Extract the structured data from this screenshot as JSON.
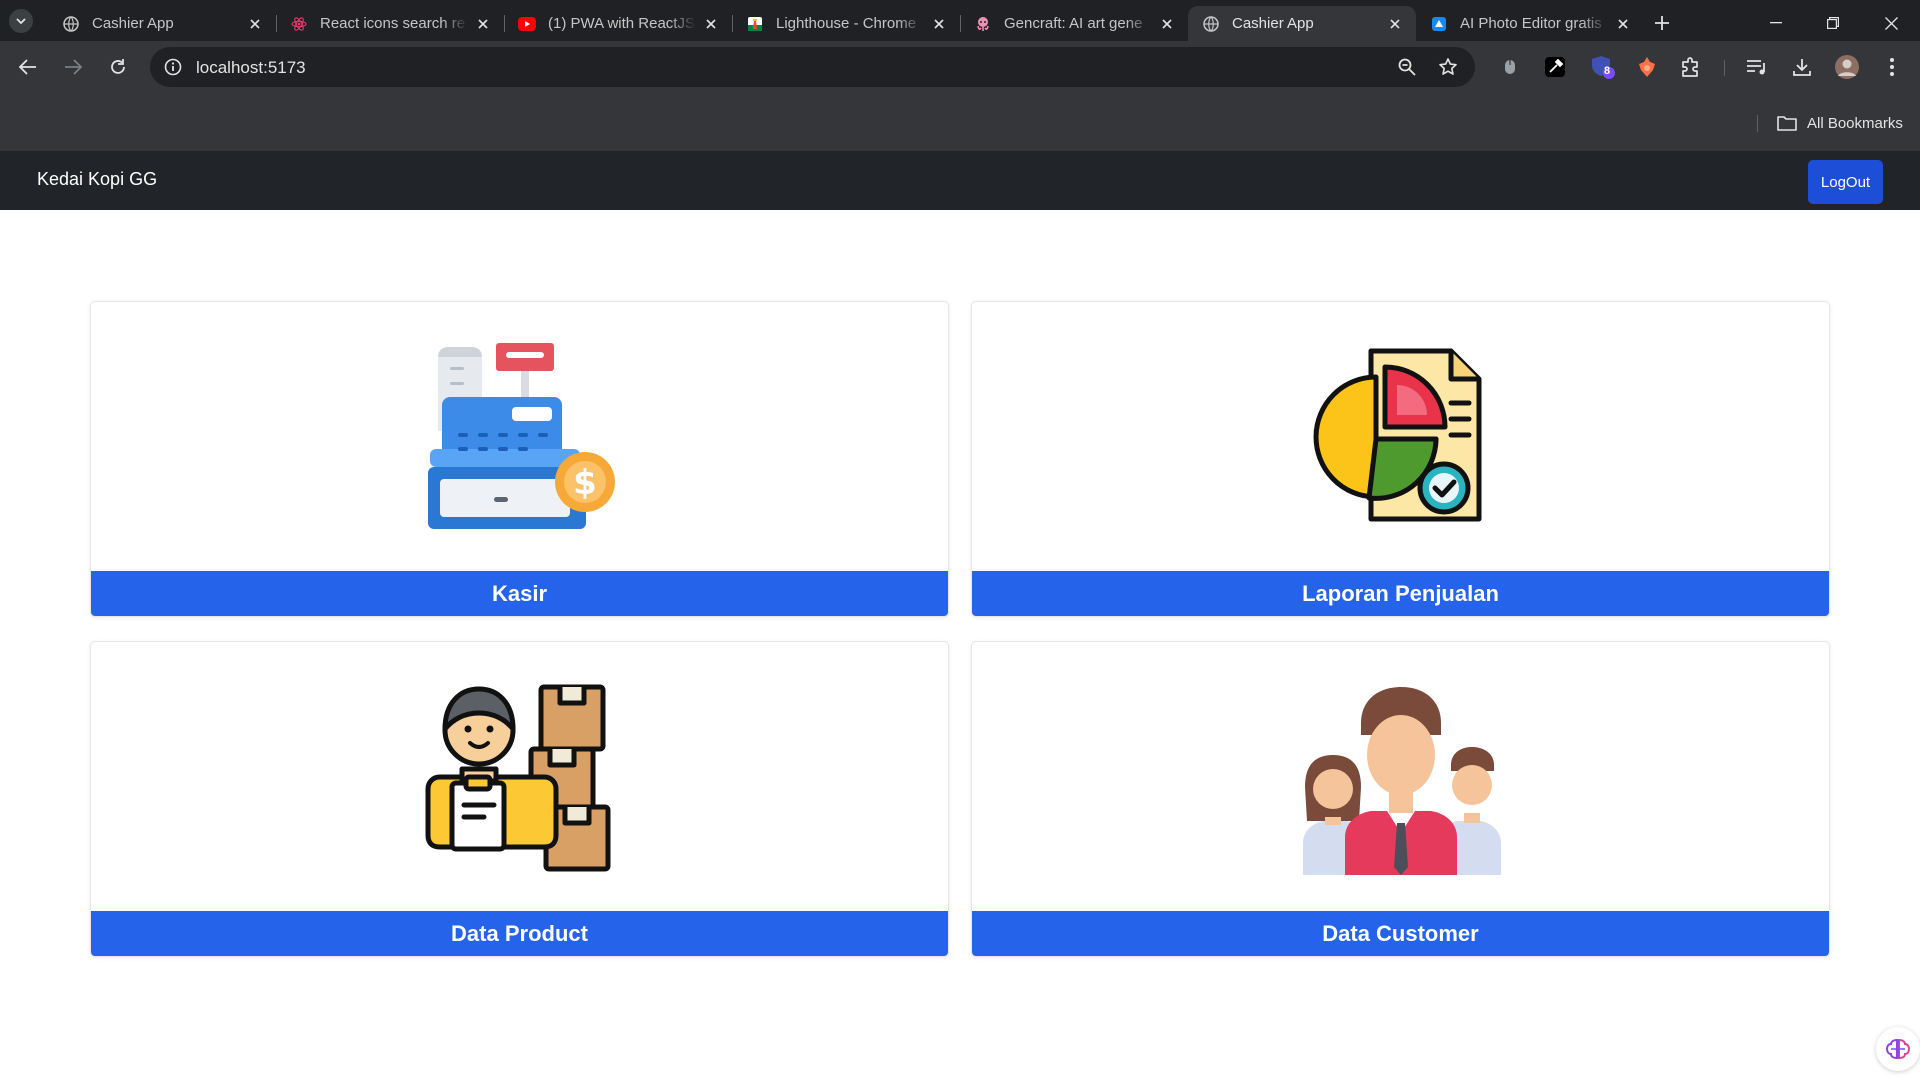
{
  "browser": {
    "tabs": [
      {
        "title": "Cashier App",
        "favicon": "globe-icon",
        "active": false
      },
      {
        "title": "React icons search re",
        "favicon": "react-icon",
        "active": false
      },
      {
        "title": "(1) PWA with ReactJS",
        "favicon": "youtube-icon",
        "active": false
      },
      {
        "title": "Lighthouse - Chrome",
        "favicon": "lighthouse-icon",
        "active": false
      },
      {
        "title": "Gencraft: AI art gene",
        "favicon": "gencraft-icon",
        "active": false
      },
      {
        "title": "Cashier App",
        "favicon": "globe-icon",
        "active": true
      },
      {
        "title": "AI Photo Editor gratis",
        "favicon": "photo-editor-icon",
        "active": false
      }
    ],
    "url": "localhost:5173",
    "bookmarks_label": "All Bookmarks",
    "extension_badge": "8"
  },
  "app": {
    "brand": "Kedai Kopi GG",
    "logout_label": "LogOut",
    "accent_color": "#2563eb",
    "menu": [
      {
        "label": "Kasir",
        "icon": "cash-register-icon"
      },
      {
        "label": "Laporan Penjualan",
        "icon": "sales-report-icon"
      },
      {
        "label": "Data Product",
        "icon": "product-data-icon"
      },
      {
        "label": "Data Customer",
        "icon": "customer-data-icon"
      }
    ]
  }
}
